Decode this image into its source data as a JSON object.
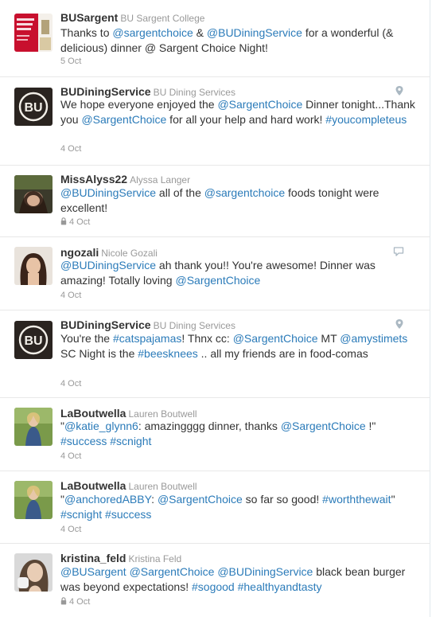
{
  "tweets": [
    {
      "name": "BUSargent",
      "display_name": "BU Sargent College",
      "segments": [
        {
          "t": "Thanks to ",
          "c": "p"
        },
        {
          "t": "@sargentchoice",
          "c": "l"
        },
        {
          "t": " & ",
          "c": "p"
        },
        {
          "t": "@BUDiningService",
          "c": "l"
        },
        {
          "t": " for a wonderful (& delicious) dinner @ Sargent Choice Night!",
          "c": "p"
        }
      ],
      "date": "5 Oct",
      "locked": false,
      "icon": "none",
      "avatar": "sargent-college-logo"
    },
    {
      "name": "BUDiningService",
      "display_name": "BU Dining Services",
      "segments": [
        {
          "t": "We hope everyone enjoyed the ",
          "c": "p"
        },
        {
          "t": "@SargentChoice",
          "c": "l"
        },
        {
          "t": " Dinner tonight...Thank you ",
          "c": "p"
        },
        {
          "t": "@SargentChoice",
          "c": "l"
        },
        {
          "t": " for all your help and hard work! ",
          "c": "p"
        },
        {
          "t": "#youcompleteus",
          "c": "l"
        }
      ],
      "date": "4 Oct",
      "locked": false,
      "icon": "location-pin-icon",
      "avatar": "bu-logo"
    },
    {
      "name": "MissAlyss22",
      "display_name": "Alyssa Langer",
      "segments": [
        {
          "t": "@BUDiningService",
          "c": "l"
        },
        {
          "t": " all of the ",
          "c": "p"
        },
        {
          "t": "@sargentchoice",
          "c": "l"
        },
        {
          "t": " foods tonight were excellent!",
          "c": "p"
        }
      ],
      "date": "4 Oct",
      "locked": true,
      "icon": "none",
      "avatar": "photo"
    },
    {
      "name": "ngozali",
      "display_name": "Nicole Gozali",
      "segments": [
        {
          "t": "@BUDiningService",
          "c": "l"
        },
        {
          "t": " ah thank you!! You're awesome! Dinner was amazing! Totally loving ",
          "c": "p"
        },
        {
          "t": "@SargentChoice",
          "c": "l"
        }
      ],
      "date": "4 Oct",
      "locked": false,
      "icon": "conversation-icon",
      "avatar": "photo"
    },
    {
      "name": "BUDiningService",
      "display_name": "BU Dining Services",
      "segments": [
        {
          "t": "You're the ",
          "c": "p"
        },
        {
          "t": "#catspajamas",
          "c": "l"
        },
        {
          "t": "! Thnx cc: ",
          "c": "p"
        },
        {
          "t": "@SargentChoice",
          "c": "l"
        },
        {
          "t": " MT ",
          "c": "p"
        },
        {
          "t": "@amystimets",
          "c": "l"
        },
        {
          "t": " SC Night is the ",
          "c": "p"
        },
        {
          "t": "#beesknees",
          "c": "l"
        },
        {
          "t": " .. all my friends are in food-comas",
          "c": "p"
        }
      ],
      "date": "4 Oct",
      "locked": false,
      "icon": "location-pin-icon",
      "avatar": "bu-logo"
    },
    {
      "name": "LaBoutwella",
      "display_name": "Lauren Boutwell",
      "segments": [
        {
          "t": "\"",
          "c": "p"
        },
        {
          "t": "@katie_glynn6",
          "c": "l"
        },
        {
          "t": ": amazingggg dinner, thanks ",
          "c": "p"
        },
        {
          "t": "@SargentChoice",
          "c": "l"
        },
        {
          "t": " !\" ",
          "c": "p"
        },
        {
          "t": "#success",
          "c": "l"
        },
        {
          "t": " ",
          "c": "p"
        },
        {
          "t": "#scnight",
          "c": "l"
        }
      ],
      "date": "4 Oct",
      "locked": false,
      "icon": "none",
      "avatar": "photo"
    },
    {
      "name": "LaBoutwella",
      "display_name": "Lauren Boutwell",
      "segments": [
        {
          "t": "\"",
          "c": "p"
        },
        {
          "t": "@anchoredABBY",
          "c": "l"
        },
        {
          "t": ": ",
          "c": "p"
        },
        {
          "t": "@SargentChoice",
          "c": "l"
        },
        {
          "t": " so far so good! ",
          "c": "p"
        },
        {
          "t": "#worththewait",
          "c": "l"
        },
        {
          "t": "\" ",
          "c": "p"
        },
        {
          "t": "#scnight",
          "c": "l"
        },
        {
          "t": " ",
          "c": "p"
        },
        {
          "t": "#success",
          "c": "l"
        }
      ],
      "date": "4 Oct",
      "locked": false,
      "icon": "none",
      "avatar": "photo"
    },
    {
      "name": "kristina_feld",
      "display_name": "Kristina Feld",
      "segments": [
        {
          "t": "@BUSargent",
          "c": "l"
        },
        {
          "t": " ",
          "c": "p"
        },
        {
          "t": "@SargentChoice",
          "c": "l"
        },
        {
          "t": " ",
          "c": "p"
        },
        {
          "t": "@BUDiningService",
          "c": "l"
        },
        {
          "t": " black bean burger was beyond expectations! ",
          "c": "p"
        },
        {
          "t": "#sogood",
          "c": "l"
        },
        {
          "t": " ",
          "c": "p"
        },
        {
          "t": "#healthyandtasty",
          "c": "l"
        }
      ],
      "date": "4 Oct",
      "locked": true,
      "icon": "none",
      "avatar": "photo"
    }
  ],
  "colors": {
    "link": "#2b7bb9",
    "text": "#333333",
    "muted": "#999999",
    "divider": "#e8e8e8"
  }
}
